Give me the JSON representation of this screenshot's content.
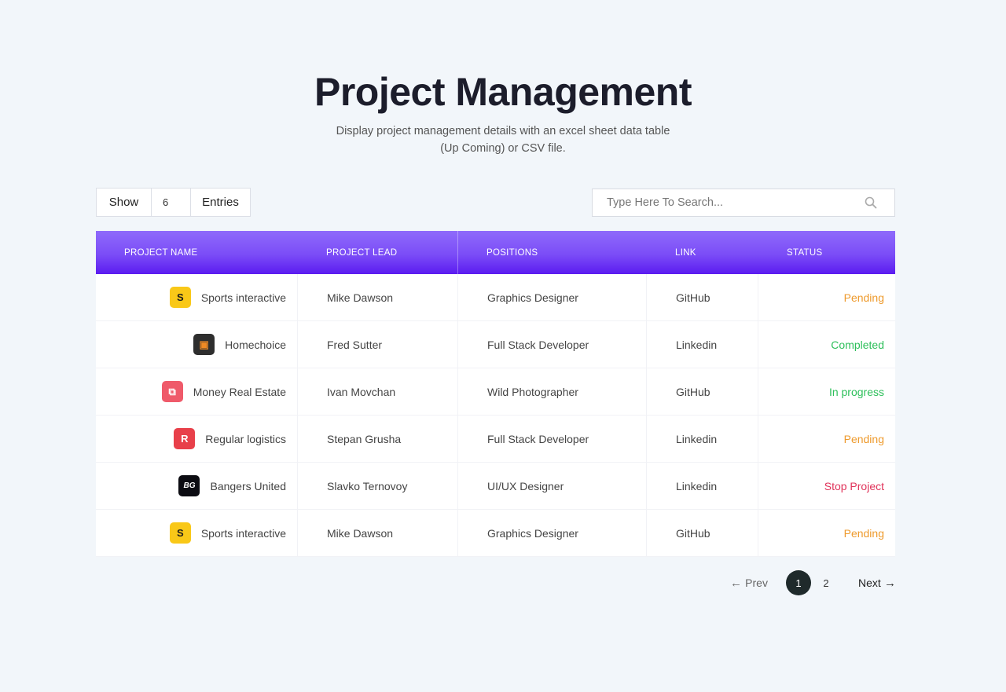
{
  "header": {
    "title": "Project Management",
    "subtitle_line1": "Display project management details with an excel sheet data table",
    "subtitle_line2": "(Up Coming) or CSV file."
  },
  "controls": {
    "show_label": "Show",
    "entries_value": "6",
    "entries_label": "Entries",
    "search_placeholder": "Type Here To Search...",
    "search_icon": "search-icon"
  },
  "table": {
    "columns": [
      "PROJECT NAME",
      "PROJECT LEAD",
      "POSITIONS",
      "LINK",
      "STATUS"
    ],
    "rows": [
      {
        "logo": "S",
        "logo_bg": "#f9c818",
        "logo_fg": "#1b1b1b",
        "name": "Sports interactive",
        "lead": "Mike Dawson",
        "position": "Graphics Designer",
        "link": "GitHub",
        "status": "Pending",
        "status_color": "#ee9a2c"
      },
      {
        "logo": "▣",
        "logo_bg": "#2e2e2e",
        "logo_fg": "#f08a24",
        "name": "Homechoice",
        "lead": "Fred Sutter",
        "position": "Full Stack Developer",
        "link": "Linkedin",
        "status": "Completed",
        "status_color": "#2dbf5a"
      },
      {
        "logo": "⧉",
        "logo_bg": "#ef5a6a",
        "logo_fg": "#ffffff",
        "name": "Money Real Estate",
        "lead": "Ivan Movchan",
        "position": "Wild Photographer",
        "link": "GitHub",
        "status": "In progress",
        "status_color": "#2dbf5a"
      },
      {
        "logo": "R",
        "logo_bg": "#e8404a",
        "logo_fg": "#ffffff",
        "name": "Regular logistics",
        "lead": "Stepan Grusha",
        "position": "Full Stack Developer",
        "link": "Linkedin",
        "status": "Pending",
        "status_color": "#ee9a2c"
      },
      {
        "logo": "BG",
        "logo_bg": "#0c0c12",
        "logo_fg": "#ffffff",
        "name": "Bangers United",
        "lead": "Slavko Ternovoy",
        "position": "UI/UX Designer",
        "link": "Linkedin",
        "status": "Stop Project",
        "status_color": "#e0335a"
      },
      {
        "logo": "S",
        "logo_bg": "#f9c818",
        "logo_fg": "#1b1b1b",
        "name": "Sports interactive",
        "lead": "Mike Dawson",
        "position": "Graphics Designer",
        "link": "GitHub",
        "status": "Pending",
        "status_color": "#ee9a2c"
      }
    ]
  },
  "pagination": {
    "prev_label": "Prev",
    "pages": [
      "1",
      "2"
    ],
    "current_page": "1",
    "next_label": "Next"
  }
}
